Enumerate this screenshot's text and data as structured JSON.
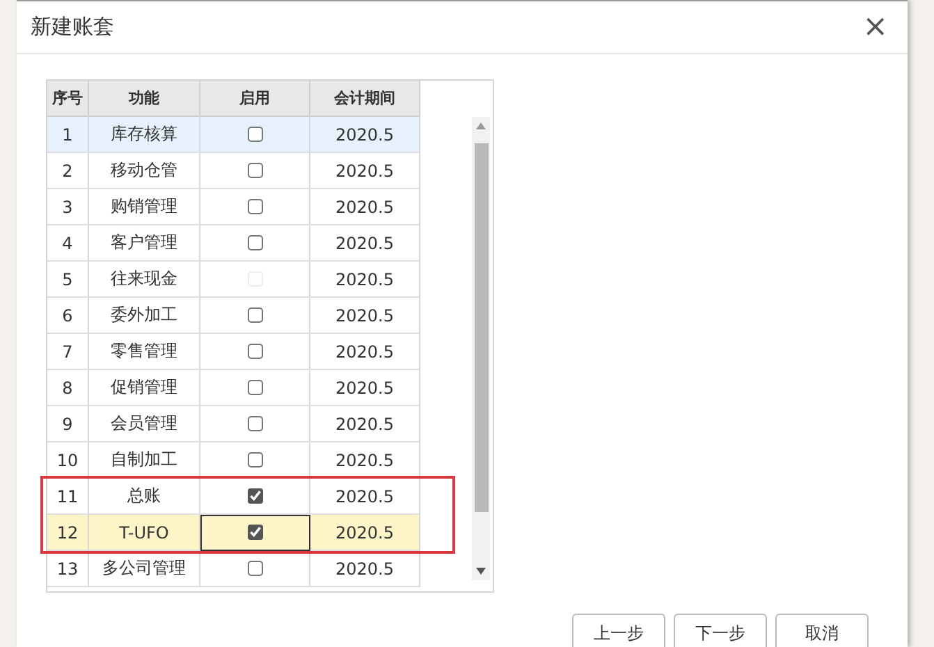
{
  "dialog": {
    "title": "新建账套",
    "close": "×"
  },
  "table": {
    "columns": [
      "序号",
      "功能",
      "启用",
      "会计期间"
    ],
    "row_groups": [
      {
        "framed": false,
        "rows": [
          {
            "no": "1",
            "name": "库存核算",
            "enabled": false,
            "disabled": false,
            "period": "2020.5",
            "hovered": true,
            "selected": false
          },
          {
            "no": "2",
            "name": "移动仓管",
            "enabled": false,
            "disabled": false,
            "period": "2020.5",
            "hovered": false,
            "selected": false
          },
          {
            "no": "3",
            "name": "购销管理",
            "enabled": false,
            "disabled": false,
            "period": "2020.5",
            "hovered": false,
            "selected": false
          },
          {
            "no": "4",
            "name": "客户管理",
            "enabled": false,
            "disabled": false,
            "period": "2020.5",
            "hovered": false,
            "selected": false
          },
          {
            "no": "5",
            "name": "往来现金",
            "enabled": false,
            "disabled": true,
            "period": "2020.5",
            "hovered": false,
            "selected": false
          },
          {
            "no": "6",
            "name": "委外加工",
            "enabled": false,
            "disabled": false,
            "period": "2020.5",
            "hovered": false,
            "selected": false
          },
          {
            "no": "7",
            "name": "零售管理",
            "enabled": false,
            "disabled": false,
            "period": "2020.5",
            "hovered": false,
            "selected": false
          },
          {
            "no": "8",
            "name": "促销管理",
            "enabled": false,
            "disabled": false,
            "period": "2020.5",
            "hovered": false,
            "selected": false
          },
          {
            "no": "9",
            "name": "会员管理",
            "enabled": false,
            "disabled": false,
            "period": "2020.5",
            "hovered": false,
            "selected": false
          },
          {
            "no": "10",
            "name": "自制加工",
            "enabled": false,
            "disabled": false,
            "period": "2020.5",
            "hovered": false,
            "selected": false
          }
        ]
      },
      {
        "framed": true,
        "rows": [
          {
            "no": "11",
            "name": "总账",
            "enabled": true,
            "disabled": false,
            "period": "2020.5",
            "hovered": false,
            "selected": false
          },
          {
            "no": "12",
            "name": "T-UFO",
            "enabled": true,
            "disabled": false,
            "period": "2020.5",
            "hovered": false,
            "selected": true
          }
        ]
      },
      {
        "framed": false,
        "rows": [
          {
            "no": "13",
            "name": "多公司管理",
            "enabled": false,
            "disabled": false,
            "period": "2020.5",
            "hovered": false,
            "selected": false
          }
        ]
      }
    ]
  },
  "buttons": [
    "上一步",
    "下一步",
    "取消"
  ]
}
